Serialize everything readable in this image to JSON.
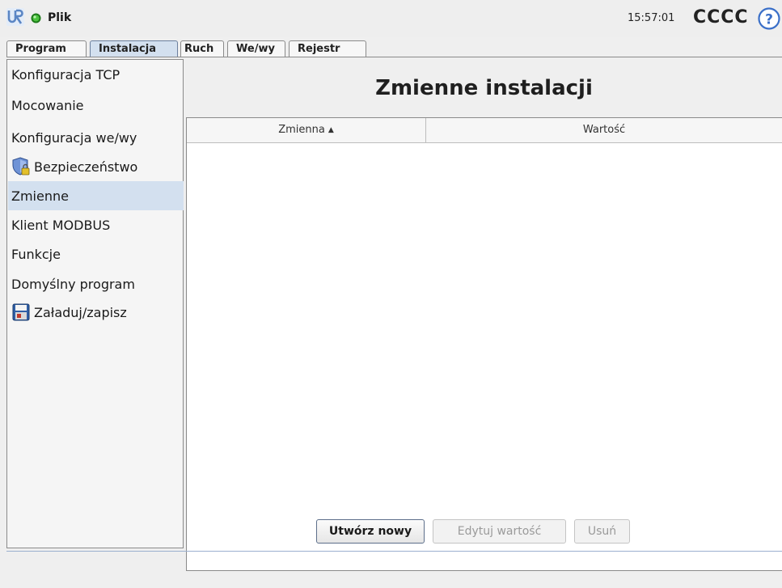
{
  "header": {
    "file_menu": "Plik",
    "clock": "15:57:01",
    "robot_name": "CCCC",
    "help_icon_glyph": "?",
    "logo_icon": "ur-logo-icon",
    "status_color": "#2e9e2a"
  },
  "tabs": [
    {
      "label": "Program"
    },
    {
      "label": "Instalacja",
      "active": true
    },
    {
      "label": "Ruch"
    },
    {
      "label": "We/wy"
    },
    {
      "label": "Rejestr"
    }
  ],
  "sidebar": {
    "items": [
      {
        "label": "Konfiguracja TCP"
      },
      {
        "label": "Mocowanie"
      },
      {
        "label": "Konfiguracja we/wy"
      },
      {
        "label": "Bezpieczeństwo",
        "icon": "shield-lock-icon"
      },
      {
        "label": "Zmienne",
        "selected": true
      },
      {
        "label": "Klient MODBUS"
      },
      {
        "label": "Funkcje"
      },
      {
        "label": "Domyślny program"
      },
      {
        "label": "Załaduj/zapisz",
        "icon": "floppy-disk-icon"
      }
    ]
  },
  "main": {
    "title": "Zmienne instalacji",
    "table": {
      "columns": [
        "Zmienna",
        "Wartość"
      ],
      "sort_indicator": "▲",
      "rows": []
    },
    "buttons": {
      "create": "Utwórz nowy",
      "edit": "Edytuj wartość",
      "delete": "Usuń"
    }
  },
  "colors": {
    "selected_bg": "#d3e0ef",
    "accent": "#3a6fc8"
  }
}
